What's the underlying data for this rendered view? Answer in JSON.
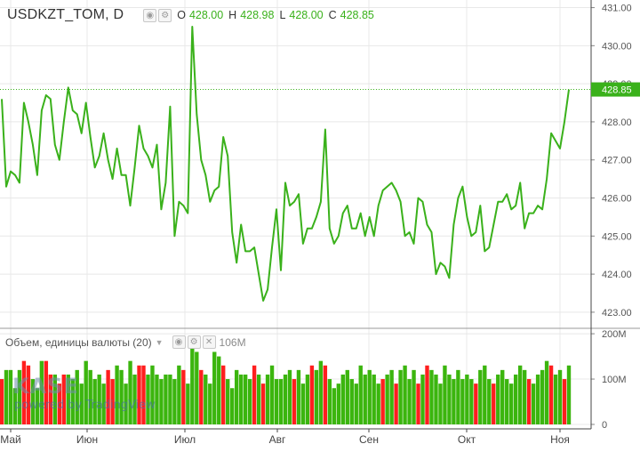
{
  "header": {
    "symbol": "USDKZT_TOM, D",
    "open_label": "O",
    "open": "428.00",
    "high_label": "H",
    "high": "428.98",
    "low_label": "L",
    "low": "428.00",
    "close_label": "C",
    "close": "428.85"
  },
  "volume_pane": {
    "title": "Объем, единицы валюты (20)",
    "value": "106M"
  },
  "watermark": {
    "logo": "KASE",
    "credit": "powered by TradingView"
  },
  "last_price_tag": "428.85",
  "colors": {
    "line": "#3ab11b",
    "up": "#3bb50e",
    "down": "#ff1e1e",
    "grid": "#e8e8e8",
    "tag": "#3ab11b"
  },
  "chart_data": {
    "type": "line",
    "x_labels": [
      "Май",
      "Июн",
      "Июл",
      "Авг",
      "Сен",
      "Окт",
      "Ноя"
    ],
    "price_axis": {
      "ticks": [
        "423.00",
        "424.00",
        "425.00",
        "426.00",
        "427.00",
        "428.00",
        "429.00",
        "430.00",
        "431.00"
      ],
      "range": [
        422.6,
        431.2
      ]
    },
    "volume_axis": {
      "ticks": [
        "0",
        "100M",
        "200M"
      ],
      "range": [
        0,
        210
      ]
    },
    "series": [
      {
        "values": [
          428.6,
          426.3,
          426.7,
          426.6,
          426.4,
          428.5,
          428.0,
          427.4,
          426.6,
          428.3,
          428.7,
          428.6,
          427.4,
          427.0,
          428.0,
          428.9,
          428.3,
          428.2,
          427.7,
          428.5,
          427.6,
          426.8,
          427.1,
          427.7,
          427.0,
          426.5,
          427.3,
          426.6,
          426.6,
          425.8,
          426.8,
          427.9,
          427.3,
          427.1,
          426.8,
          427.4,
          425.7,
          426.4,
          428.4,
          425.0,
          425.9,
          425.8,
          425.6,
          430.5,
          428.2,
          427.0,
          426.6,
          425.9,
          426.2,
          426.3,
          427.6,
          427.1,
          425.1,
          424.3,
          425.3,
          424.6,
          424.6,
          424.7,
          424.0,
          423.3,
          423.6,
          424.7,
          425.7,
          424.1,
          426.4,
          425.8,
          425.9,
          426.1,
          424.8,
          425.2,
          425.2,
          425.5,
          425.9,
          427.8,
          425.2,
          424.8,
          425.0,
          425.6,
          425.8,
          425.2,
          425.2,
          425.6,
          425.0,
          425.5,
          425.0,
          425.8,
          426.2,
          426.3,
          426.4,
          426.2,
          425.9,
          425.0,
          425.1,
          424.8,
          426.0,
          425.9,
          425.3,
          425.1,
          424.0,
          424.3,
          424.2,
          423.9,
          425.3,
          426.0,
          426.3,
          425.5,
          425.0,
          425.1,
          425.8,
          424.6,
          424.7,
          425.3,
          425.9,
          425.9,
          426.1,
          425.7,
          425.8,
          426.4,
          425.2,
          425.6,
          425.6,
          425.8,
          425.7,
          426.5,
          427.7,
          427.5,
          427.3,
          428.0,
          428.85
        ]
      }
    ],
    "volume": [
      [
        10,
        1
      ],
      [
        12,
        0
      ],
      [
        12,
        0
      ],
      [
        8,
        0
      ],
      [
        12,
        0
      ],
      [
        14,
        1
      ],
      [
        13,
        1
      ],
      [
        10,
        0
      ],
      [
        8,
        0
      ],
      [
        14,
        0
      ],
      [
        14,
        1
      ],
      [
        11,
        1
      ],
      [
        11,
        0
      ],
      [
        9,
        1
      ],
      [
        11,
        1
      ],
      [
        11,
        0
      ],
      [
        10,
        0
      ],
      [
        12,
        0
      ],
      [
        9,
        0
      ],
      [
        14,
        0
      ],
      [
        12,
        0
      ],
      [
        10,
        0
      ],
      [
        11,
        0
      ],
      [
        9,
        0
      ],
      [
        12,
        1
      ],
      [
        10,
        1
      ],
      [
        13,
        0
      ],
      [
        12,
        0
      ],
      [
        9,
        0
      ],
      [
        14,
        0
      ],
      [
        11,
        0
      ],
      [
        13,
        1
      ],
      [
        13,
        1
      ],
      [
        11,
        0
      ],
      [
        13,
        0
      ],
      [
        11,
        0
      ],
      [
        10,
        0
      ],
      [
        11,
        0
      ],
      [
        11,
        0
      ],
      [
        10,
        0
      ],
      [
        13,
        0
      ],
      [
        12,
        1
      ],
      [
        9,
        0
      ],
      [
        18,
        0
      ],
      [
        16,
        0
      ],
      [
        12,
        1
      ],
      [
        11,
        0
      ],
      [
        9,
        0
      ],
      [
        16,
        0
      ],
      [
        15,
        0
      ],
      [
        13,
        1
      ],
      [
        10,
        0
      ],
      [
        8,
        0
      ],
      [
        12,
        0
      ],
      [
        11,
        0
      ],
      [
        11,
        0
      ],
      [
        10,
        0
      ],
      [
        13,
        1
      ],
      [
        11,
        0
      ],
      [
        9,
        1
      ],
      [
        11,
        0
      ],
      [
        13,
        0
      ],
      [
        10,
        0
      ],
      [
        10,
        0
      ],
      [
        11,
        0
      ],
      [
        12,
        0
      ],
      [
        10,
        1
      ],
      [
        12,
        0
      ],
      [
        9,
        0
      ],
      [
        11,
        0
      ],
      [
        13,
        1
      ],
      [
        12,
        0
      ],
      [
        14,
        0
      ],
      [
        13,
        1
      ],
      [
        10,
        0
      ],
      [
        8,
        0
      ],
      [
        9,
        0
      ],
      [
        11,
        0
      ],
      [
        12,
        0
      ],
      [
        10,
        0
      ],
      [
        9,
        0
      ],
      [
        13,
        0
      ],
      [
        11,
        0
      ],
      [
        12,
        0
      ],
      [
        11,
        0
      ],
      [
        9,
        0
      ],
      [
        10,
        1
      ],
      [
        11,
        0
      ],
      [
        12,
        0
      ],
      [
        9,
        1
      ],
      [
        12,
        0
      ],
      [
        13,
        0
      ],
      [
        10,
        0
      ],
      [
        12,
        0
      ],
      [
        9,
        1
      ],
      [
        11,
        0
      ],
      [
        13,
        1
      ],
      [
        12,
        0
      ],
      [
        11,
        0
      ],
      [
        9,
        0
      ],
      [
        13,
        0
      ],
      [
        11,
        0
      ],
      [
        10,
        0
      ],
      [
        12,
        0
      ],
      [
        10,
        0
      ],
      [
        11,
        0
      ],
      [
        10,
        0
      ],
      [
        9,
        1
      ],
      [
        12,
        0
      ],
      [
        13,
        0
      ],
      [
        10,
        0
      ],
      [
        9,
        1
      ],
      [
        11,
        0
      ],
      [
        12,
        0
      ],
      [
        10,
        0
      ],
      [
        9,
        0
      ],
      [
        11,
        0
      ],
      [
        13,
        0
      ],
      [
        12,
        0
      ],
      [
        10,
        1
      ],
      [
        9,
        0
      ],
      [
        11,
        0
      ],
      [
        12,
        0
      ],
      [
        14,
        0
      ],
      [
        13,
        1
      ],
      [
        11,
        0
      ],
      [
        12,
        0
      ],
      [
        10,
        1
      ],
      [
        13,
        0
      ]
    ]
  }
}
